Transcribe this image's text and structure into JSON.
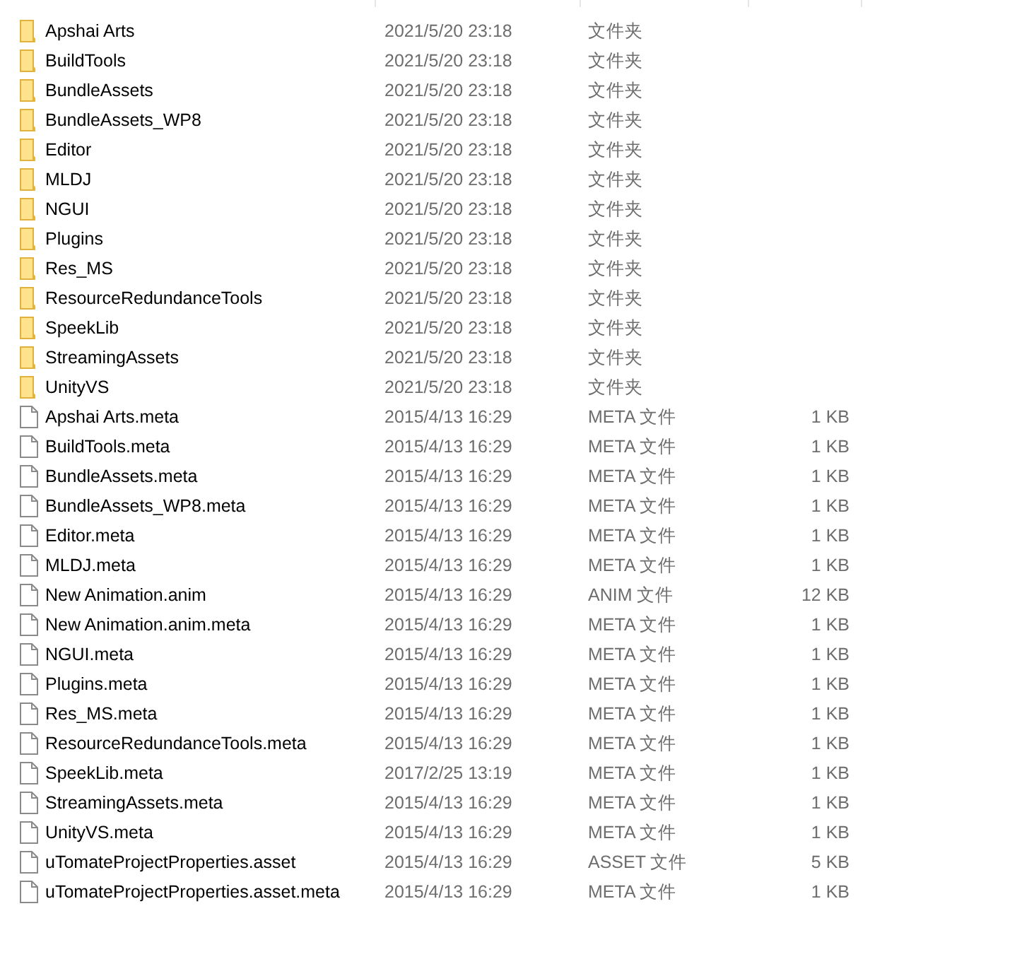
{
  "files": [
    {
      "kind": "folder",
      "name": "Apshai Arts",
      "date": "2021/5/20 23:18",
      "type": "文件夹"
    },
    {
      "kind": "folder",
      "name": "BuildTools",
      "date": "2021/5/20 23:18",
      "type": "文件夹"
    },
    {
      "kind": "folder",
      "name": "BundleAssets",
      "date": "2021/5/20 23:18",
      "type": "文件夹"
    },
    {
      "kind": "folder",
      "name": "BundleAssets_WP8",
      "date": "2021/5/20 23:18",
      "type": "文件夹"
    },
    {
      "kind": "folder",
      "name": "Editor",
      "date": "2021/5/20 23:18",
      "type": "文件夹"
    },
    {
      "kind": "folder",
      "name": "MLDJ",
      "date": "2021/5/20 23:18",
      "type": "文件夹"
    },
    {
      "kind": "folder",
      "name": "NGUI",
      "date": "2021/5/20 23:18",
      "type": "文件夹"
    },
    {
      "kind": "folder",
      "name": "Plugins",
      "date": "2021/5/20 23:18",
      "type": "文件夹"
    },
    {
      "kind": "folder",
      "name": "Res_MS",
      "date": "2021/5/20 23:18",
      "type": "文件夹"
    },
    {
      "kind": "folder",
      "name": "ResourceRedundanceTools",
      "date": "2021/5/20 23:18",
      "type": "文件夹"
    },
    {
      "kind": "folder",
      "name": "SpeekLib",
      "date": "2021/5/20 23:18",
      "type": "文件夹"
    },
    {
      "kind": "folder",
      "name": "StreamingAssets",
      "date": "2021/5/20 23:18",
      "type": "文件夹"
    },
    {
      "kind": "folder",
      "name": "UnityVS",
      "date": "2021/5/20 23:18",
      "type": "文件夹"
    },
    {
      "kind": "file",
      "name": "Apshai Arts.meta",
      "date": "2015/4/13 16:29",
      "type": "META 文件",
      "size": "1 KB"
    },
    {
      "kind": "file",
      "name": "BuildTools.meta",
      "date": "2015/4/13 16:29",
      "type": "META 文件",
      "size": "1 KB"
    },
    {
      "kind": "file",
      "name": "BundleAssets.meta",
      "date": "2015/4/13 16:29",
      "type": "META 文件",
      "size": "1 KB"
    },
    {
      "kind": "file",
      "name": "BundleAssets_WP8.meta",
      "date": "2015/4/13 16:29",
      "type": "META 文件",
      "size": "1 KB"
    },
    {
      "kind": "file",
      "name": "Editor.meta",
      "date": "2015/4/13 16:29",
      "type": "META 文件",
      "size": "1 KB"
    },
    {
      "kind": "file",
      "name": "MLDJ.meta",
      "date": "2015/4/13 16:29",
      "type": "META 文件",
      "size": "1 KB"
    },
    {
      "kind": "file",
      "name": "New Animation.anim",
      "date": "2015/4/13 16:29",
      "type": "ANIM 文件",
      "size": "12 KB"
    },
    {
      "kind": "file",
      "name": "New Animation.anim.meta",
      "date": "2015/4/13 16:29",
      "type": "META 文件",
      "size": "1 KB"
    },
    {
      "kind": "file",
      "name": "NGUI.meta",
      "date": "2015/4/13 16:29",
      "type": "META 文件",
      "size": "1 KB"
    },
    {
      "kind": "file",
      "name": "Plugins.meta",
      "date": "2015/4/13 16:29",
      "type": "META 文件",
      "size": "1 KB"
    },
    {
      "kind": "file",
      "name": "Res_MS.meta",
      "date": "2015/4/13 16:29",
      "type": "META 文件",
      "size": "1 KB"
    },
    {
      "kind": "file",
      "name": "ResourceRedundanceTools.meta",
      "date": "2015/4/13 16:29",
      "type": "META 文件",
      "size": "1 KB"
    },
    {
      "kind": "file",
      "name": "SpeekLib.meta",
      "date": "2017/2/25 13:19",
      "type": "META 文件",
      "size": "1 KB"
    },
    {
      "kind": "file",
      "name": "StreamingAssets.meta",
      "date": "2015/4/13 16:29",
      "type": "META 文件",
      "size": "1 KB"
    },
    {
      "kind": "file",
      "name": "UnityVS.meta",
      "date": "2015/4/13 16:29",
      "type": "META 文件",
      "size": "1 KB"
    },
    {
      "kind": "file",
      "name": "uTomateProjectProperties.asset",
      "date": "2015/4/13 16:29",
      "type": "ASSET 文件",
      "size": "5 KB"
    },
    {
      "kind": "file",
      "name": "uTomateProjectProperties.asset.meta",
      "date": "2015/4/13 16:29",
      "type": "META 文件",
      "size": "1 KB"
    }
  ]
}
